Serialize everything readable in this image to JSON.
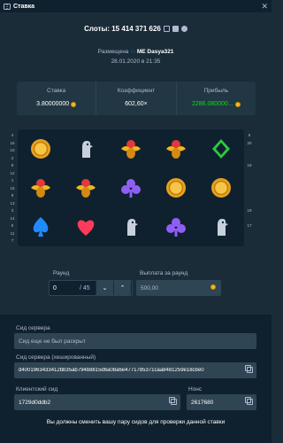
{
  "modal": {
    "title": "Ставка",
    "close": "✕"
  },
  "header": {
    "game_bet": "Слоты: 15 414 371 626"
  },
  "placed": {
    "prefix": "Размещена",
    "badge": "ME",
    "user": "Dasya321",
    "date": "28.01.2020 в 21:35"
  },
  "stats": [
    {
      "label": "Ставка",
      "value": "3.80000000"
    },
    {
      "label": "Коэффициент",
      "value": "602,60×"
    },
    {
      "label": "Прибыль",
      "value": "2286.080000..."
    }
  ],
  "paylines_left": [
    "4",
    "16",
    "10",
    "2",
    "8",
    "12",
    "1",
    "15",
    "9",
    "13",
    "3",
    "14",
    "5",
    "11",
    "7"
  ],
  "paylines_right": [
    "6",
    "20",
    "",
    "",
    "18",
    "",
    "",
    "",
    "",
    "",
    "19",
    "",
    "17",
    "",
    ""
  ],
  "reels": [
    [
      "coin",
      "bird",
      "scarab",
      "scarab",
      "diamond"
    ],
    [
      "scarab",
      "scarab",
      "club",
      "coin",
      "coin"
    ],
    [
      "spade",
      "heart",
      "bird",
      "club",
      "bird"
    ]
  ],
  "round": {
    "label": "Раунд",
    "current": "0",
    "total": "/ 45",
    "down": "⌄",
    "up": "⌃"
  },
  "payout": {
    "label": "Выплата за раунд",
    "value": "500,00"
  },
  "fairness": {
    "server_seed_label": "Сид сервера",
    "server_seed_value": "Сид еще не был раскрыт",
    "hashed_label": "Сид сервера (хешированный)",
    "hashed_value": "d4001963433412bb35ab794b8815d6a08a6e4771785371caa8481259e18cbe0",
    "client_label": "Клиентский сид",
    "client_value": "1729d0ddb2",
    "nonce_label": "Нонс",
    "nonce_value": "2617680",
    "change_text": "Вы должны сменить вашу пару сидов для проверки данной ставки"
  },
  "colors": {
    "bg": "#1a2c38",
    "panel": "#0f212e",
    "win": "#00e701",
    "accent": "#1475e1"
  }
}
